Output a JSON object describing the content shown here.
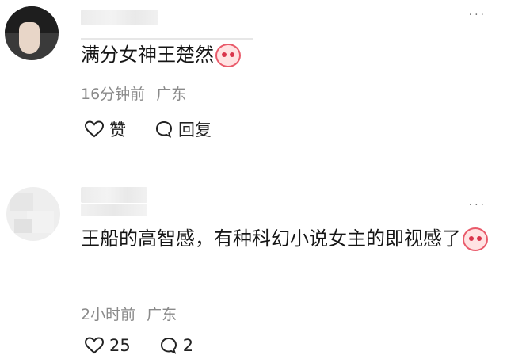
{
  "comments": [
    {
      "name": "",
      "text": "满分女神王楚然",
      "time": "16分钟前",
      "location": "广东",
      "like_label": "赞",
      "reply_label": "回复",
      "more": "···"
    },
    {
      "name": "",
      "text": "王船的高智感，有种科幻小说女主的即视感了",
      "time": "2小时前",
      "location": "广东",
      "like_label": "25",
      "reply_label": "2",
      "more": "···"
    }
  ],
  "icons": [
    "heart-icon",
    "comment-bubble-icon",
    "emoji-icon",
    "more-icon"
  ],
  "colors": {
    "text": "#151515",
    "meta": "#8a8a8a",
    "emoji_accent": "#e95a6a"
  }
}
